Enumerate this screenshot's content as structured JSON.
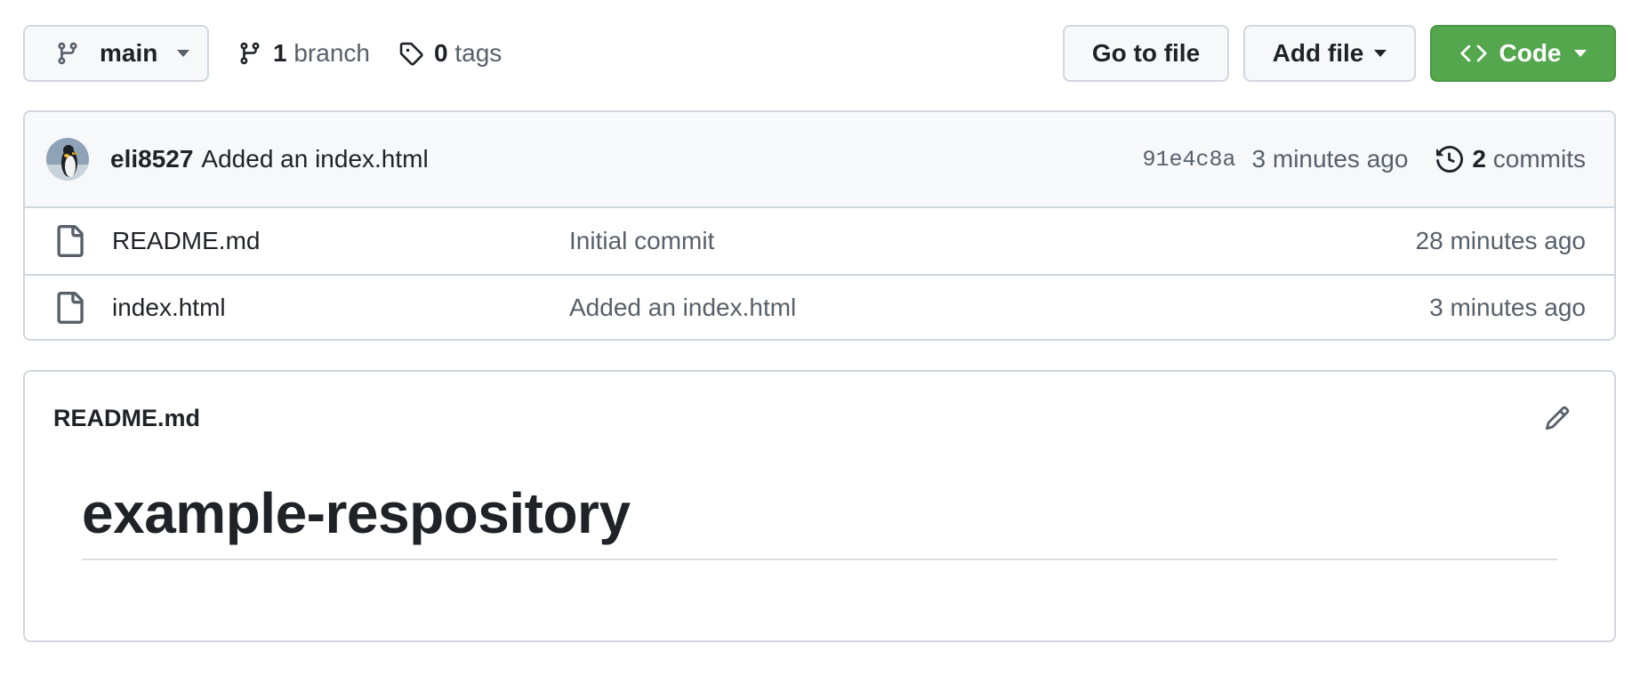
{
  "toolbar": {
    "branch_name": "main",
    "branch_count": "1",
    "branch_label": "branch",
    "tag_count": "0",
    "tag_label": "tags",
    "go_to_file_label": "Go to file",
    "add_file_label": "Add file",
    "code_label": "Code"
  },
  "latest_commit": {
    "author": "eli8527",
    "message": "Added an index.html",
    "hash": "91e4c8a",
    "time": "3 minutes ago",
    "commit_count": "2",
    "commit_label": "commits"
  },
  "files": [
    {
      "name": "README.md",
      "commit_message": "Initial commit",
      "time": "28 minutes ago",
      "icon": "file-icon"
    },
    {
      "name": "index.html",
      "commit_message": "Added an index.html",
      "time": "3 minutes ago",
      "icon": "file-icon"
    }
  ],
  "readme": {
    "filename": "README.md",
    "heading": "example-respository"
  },
  "colors": {
    "primary_button": "#55a74e",
    "border": "#d0d7de",
    "muted_text": "#57606a"
  }
}
